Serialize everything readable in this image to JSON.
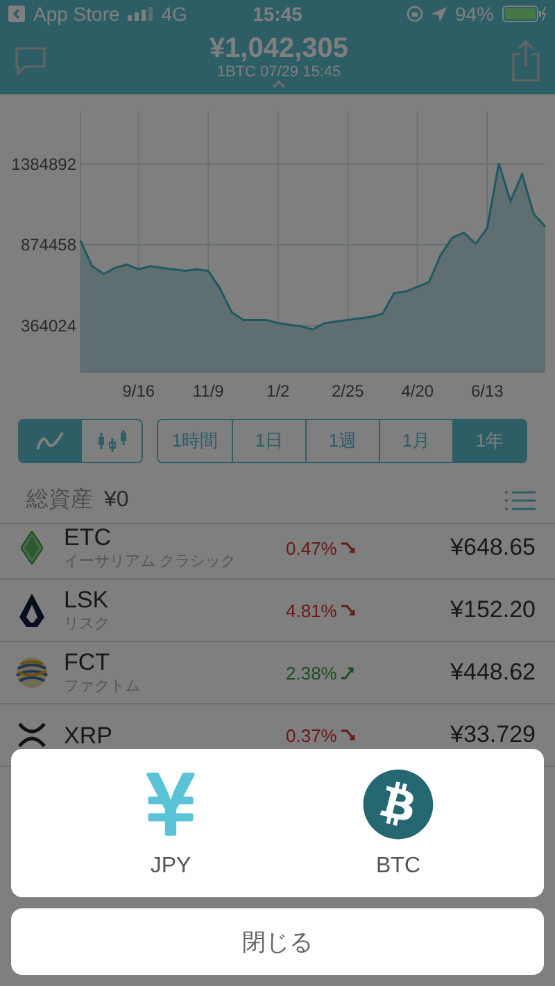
{
  "status_bar": {
    "back_label": "App Store",
    "network": "4G",
    "time": "15:45",
    "battery": "94%"
  },
  "header": {
    "price": "¥1,042,305",
    "subtitle": "1BTC  07/29 15:45"
  },
  "chart": {
    "chart_data": {
      "type": "area",
      "categories": [
        null,
        null,
        null,
        null,
        null,
        "9/16",
        null,
        null,
        null,
        null,
        null,
        "11/9",
        null,
        null,
        null,
        null,
        null,
        "1/2",
        null,
        null,
        null,
        null,
        null,
        "2/25",
        null,
        null,
        null,
        null,
        null,
        "4/20",
        null,
        null,
        null,
        null,
        null,
        "6/13",
        null,
        null,
        null,
        null,
        null
      ],
      "series": [
        {
          "color": "#3fb3c0",
          "values": [
            900000,
            740000,
            690000,
            730000,
            750000,
            720000,
            740000,
            730000,
            720000,
            710000,
            720000,
            710000,
            600000,
            450000,
            400000,
            400000,
            400000,
            380000,
            370000,
            360000,
            340000,
            380000,
            390000,
            400000,
            410000,
            420000,
            440000,
            570000,
            580000,
            610000,
            640000,
            810000,
            920000,
            950000,
            880000,
            980000,
            1390000,
            1150000,
            1320000,
            1070000,
            990000
          ]
        }
      ],
      "grid": true,
      "ylim": [
        65000,
        1720000
      ],
      "yticks": [
        364024,
        874458,
        1384892
      ]
    }
  },
  "chart_styles": [
    {
      "kind": "line",
      "selected": true
    },
    {
      "kind": "candle",
      "selected": false
    }
  ],
  "periods": [
    {
      "label": "1時間",
      "selected": false
    },
    {
      "label": "1日",
      "selected": false
    },
    {
      "label": "1週",
      "selected": false
    },
    {
      "label": "1月",
      "selected": false
    },
    {
      "label": "1年",
      "selected": true
    }
  ],
  "assets": {
    "label": "総資産",
    "value": "¥0"
  },
  "coins": [
    {
      "kind": "etc",
      "symbol": "ETC",
      "name": "イーサリアム クラシック",
      "change": "0.47%",
      "rising": false,
      "price": "¥648.65"
    },
    {
      "kind": "lsk",
      "symbol": "LSK",
      "name": "リスク",
      "change": "4.81%",
      "rising": false,
      "price": "¥152.20"
    },
    {
      "kind": "fct",
      "symbol": "FCT",
      "name": "ファクトム",
      "change": "2.38%",
      "rising": true,
      "price": "¥448.62"
    },
    {
      "kind": "xrp",
      "symbol": "XRP",
      "change": "0.37%",
      "rising": false,
      "price": "¥33.729"
    }
  ],
  "sheet": {
    "options": [
      {
        "kind": "yen",
        "label": "JPY"
      },
      {
        "kind": "bitcoin",
        "label": "BTC"
      }
    ],
    "close": "閉じる"
  }
}
